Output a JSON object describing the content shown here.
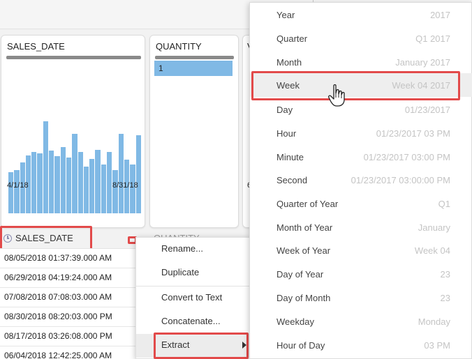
{
  "profile_cards": {
    "sales_date": {
      "title": "SALES_DATE",
      "x_start": "4/1/18",
      "x_end": "8/31/18",
      "histogram_relative_heights": [
        0.36,
        0.38,
        0.45,
        0.51,
        0.54,
        0.53,
        0.81,
        0.55,
        0.5,
        0.58,
        0.49,
        0.7,
        0.54,
        0.41,
        0.48,
        0.56,
        0.43,
        0.54,
        0.38,
        0.7,
        0.47,
        0.43,
        0.69
      ]
    },
    "quantity": {
      "title": "QUANTITY",
      "value": "1"
    },
    "third": {
      "title_partial": "V",
      "axis_partial": "6"
    }
  },
  "column_headers": {
    "sales_date": "SALES_DATE",
    "quantity_partial": "QUANTITY"
  },
  "table_rows": [
    "08/05/2018 01:37:39.000 AM",
    "06/29/2018 04:19:24.000 AM",
    "07/08/2018 07:08:03.000 AM",
    "08/30/2018 08:20:03.000 PM",
    "08/17/2018 03:26:08.000 PM",
    "06/04/2018 12:42:25.000 AM"
  ],
  "context_menu": {
    "items": [
      "Rename...",
      "Duplicate",
      "Convert to Text",
      "Concatenate...",
      "Extract"
    ]
  },
  "extract_submenu": {
    "items": [
      {
        "label": "Year",
        "example": "2017"
      },
      {
        "label": "Quarter",
        "example": "Q1 2017"
      },
      {
        "label": "Month",
        "example": "January 2017"
      },
      {
        "label": "Week",
        "example": "Week 04 2017"
      },
      {
        "label": "Day",
        "example": "01/23/2017"
      },
      {
        "label": "Hour",
        "example": "01/23/2017 03 PM"
      },
      {
        "label": "Minute",
        "example": "01/23/2017 03:00 PM"
      },
      {
        "label": "Second",
        "example": "01/23/2017 03:00:00 PM"
      },
      {
        "label": "Quarter of Year",
        "example": "Q1"
      },
      {
        "label": "Month of Year",
        "example": "January"
      },
      {
        "label": "Week of Year",
        "example": "Week 04"
      },
      {
        "label": "Day of Year",
        "example": "23"
      },
      {
        "label": "Day of Month",
        "example": "23"
      },
      {
        "label": "Weekday",
        "example": "Monday"
      },
      {
        "label": "Hour of Day",
        "example": "03 PM"
      }
    ],
    "hovered": "Week"
  },
  "colors": {
    "highlight_red": "#e24a4a",
    "bar_blue": "#80b9e5",
    "menu_hover": "#eeeeee"
  }
}
